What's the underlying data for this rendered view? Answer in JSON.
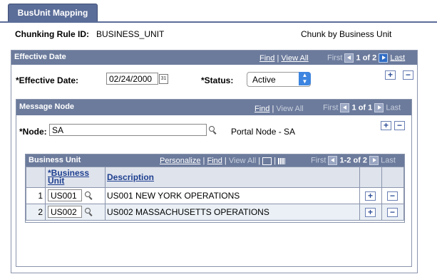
{
  "tab": {
    "label": "BusUnit Mapping"
  },
  "header": {
    "chunking_rule_label": "Chunking Rule ID:",
    "chunking_rule_value": "BUSINESS_UNIT",
    "description": "Chunk by Business Unit"
  },
  "effective_date_section": {
    "title": "Effective Date",
    "nav": {
      "find": "Find",
      "view_all": "View All",
      "first": "First",
      "count": "1 of 2",
      "last": "Last"
    },
    "effective_date_label": "*Effective Date:",
    "effective_date_value": "02/24/2000",
    "status_label": "*Status:",
    "status_value": "Active"
  },
  "message_node_section": {
    "title": "Message Node",
    "nav": {
      "find": "Find",
      "view_all": "View All",
      "first": "First",
      "count": "1 of 1",
      "last": "Last"
    },
    "node_label": "*Node:",
    "node_value": "SA",
    "node_description": "Portal Node - SA"
  },
  "business_unit_grid": {
    "title": "Business Unit",
    "nav": {
      "personalize": "Personalize",
      "find": "Find",
      "view_all": "View All",
      "first": "First",
      "count": "1-2 of 2",
      "last": "Last"
    },
    "columns": {
      "business_unit_line1": "*Business",
      "business_unit_line2": "Unit",
      "description": "Description"
    },
    "rows": [
      {
        "num": "1",
        "business_unit": "US001",
        "description": "US001 NEW YORK OPERATIONS"
      },
      {
        "num": "2",
        "business_unit": "US002",
        "description": "US002 MASSACHUSETTS OPERATIONS"
      }
    ]
  },
  "icons": {
    "add": "+",
    "delete": "−",
    "calendar": "31"
  },
  "colors": {
    "header_bg": "#6c7b9c",
    "tab_bg": "#5b6d99",
    "link": "#1d3f8f"
  }
}
